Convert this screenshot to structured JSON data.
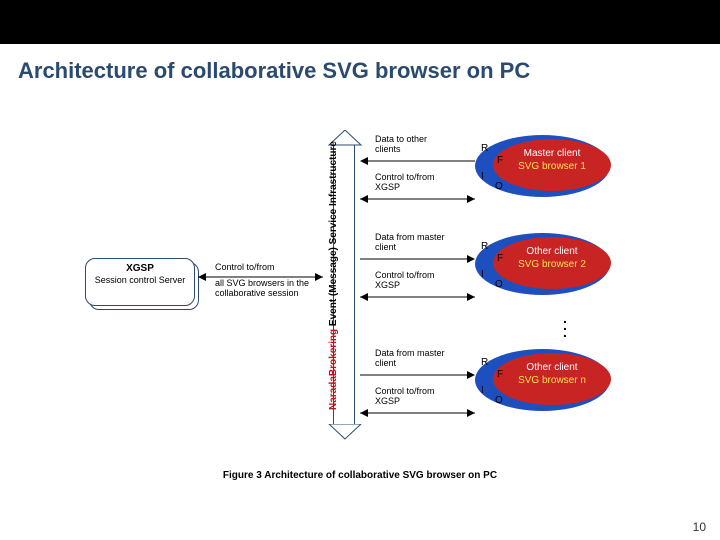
{
  "title": "Architecture of collaborative SVG browser on PC",
  "xgsp": {
    "name": "XGSP",
    "sub": "Session control Server"
  },
  "xgsp_arrow": {
    "label": "Control to/from",
    "sub": "all SVG browsers in the collaborative session"
  },
  "broker": {
    "line1": "NaradaBrokering",
    "line2": "Event (Message) Service Infrastructure"
  },
  "flows": {
    "master_top": "Data to other clients",
    "master_bot": "Control to/from XGSP",
    "other1_top": "Data from master client",
    "other1_bot": "Control to/from XGSP",
    "other2_top": "Data from master client",
    "other2_bot": "Control to/from XGSP"
  },
  "clients": {
    "master": {
      "role": "Master client",
      "app": "SVG browser 1"
    },
    "other1": {
      "role": "Other client",
      "app": "SVG browser 2"
    },
    "other2": {
      "role": "Other client",
      "app": "SVG browser n"
    }
  },
  "letters": {
    "r": "R",
    "f": "F",
    "i": "I",
    "o": "O"
  },
  "caption": "Figure 3  Architecture of collaborative  SVG browser on PC",
  "pagenum": "10"
}
